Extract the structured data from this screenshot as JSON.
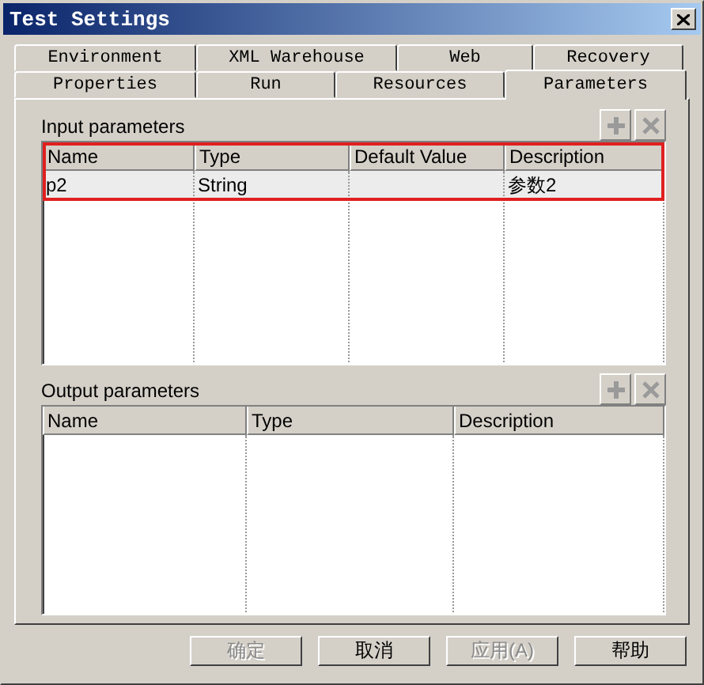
{
  "window": {
    "title": "Test Settings"
  },
  "tab_rows": [
    {
      "tabs": [
        {
          "label": "Environment",
          "selected": false
        },
        {
          "label": "XML Warehouse",
          "selected": false
        },
        {
          "label": "Web",
          "selected": false
        },
        {
          "label": "Recovery",
          "selected": false
        }
      ]
    },
    {
      "tabs": [
        {
          "label": "Properties",
          "selected": false
        },
        {
          "label": "Run",
          "selected": false
        },
        {
          "label": "Resources",
          "selected": false
        },
        {
          "label": "Parameters",
          "selected": true
        }
      ]
    }
  ],
  "input_parameters": {
    "label": "Input parameters",
    "highlighted": true,
    "columns": [
      "Name",
      "Type",
      "Default Value",
      "Description"
    ],
    "rows": [
      {
        "cells": [
          "p2",
          "String",
          null,
          "参数2"
        ]
      }
    ]
  },
  "output_parameters": {
    "label": "Output parameters",
    "highlighted": false,
    "columns": [
      "Name",
      "Type",
      "Description"
    ]
  },
  "buttons": [
    {
      "label": "确定",
      "disabled": true
    },
    {
      "label": "取消",
      "disabled": false
    },
    {
      "label": "应用(A)",
      "disabled": true
    },
    {
      "label": "帮助",
      "disabled": false
    }
  ]
}
